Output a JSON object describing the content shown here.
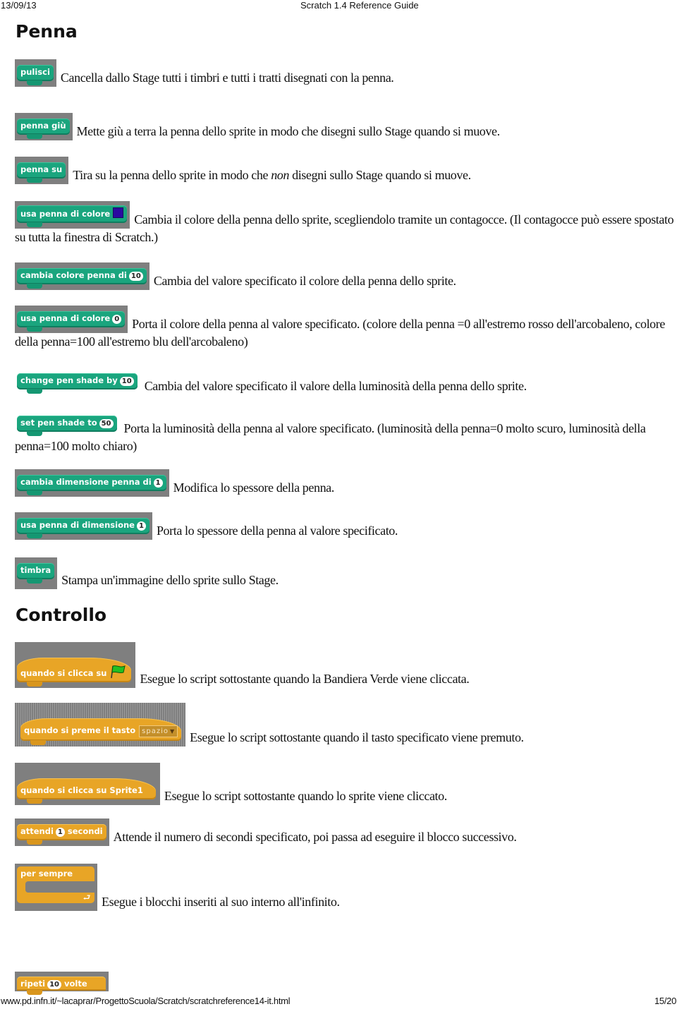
{
  "header": {
    "date": "13/09/13",
    "title": "Scratch 1.4 Reference Guide"
  },
  "footer": {
    "url": "www.pd.infn.it/~lacaprar/ProgettoScuola/Scratch/scratchreference14-it.html",
    "page": "15/20"
  },
  "sections": {
    "penna": {
      "title": "Penna",
      "blocks": [
        {
          "label": "pulisci",
          "desc": "Cancella dallo Stage tutti i timbri e tutti i tratti disegnati con la penna."
        },
        {
          "label": "penna giù",
          "desc": "Mette giù a terra la penna dello sprite in modo che disegni sullo Stage quando si muove."
        },
        {
          "label": "penna su",
          "desc_before": "Tira su la penna dello sprite in modo che ",
          "desc_em": "non",
          "desc_after": " disegni sullo Stage quando si muove."
        },
        {
          "label": "usa penna di colore",
          "swatch_color": "#2a0aa0",
          "desc": "Cambia il colore della penna dello sprite, scegliendolo tramite un contagocce. (Il contagocce può essere spostato su tutta la finestra di Scratch.)"
        },
        {
          "label": "cambia colore penna di",
          "value": "10",
          "desc": "Cambia del valore specificato il colore della penna dello sprite."
        },
        {
          "label": "usa penna di colore",
          "value": "0",
          "desc": "Porta il colore della penna al valore specificato. (colore della penna =0 all'estremo rosso dell'arcobaleno, colore della penna=100 all'estremo blu dell'arcobaleno)"
        },
        {
          "label": "change pen shade by",
          "value": "10",
          "desc": "Cambia del valore specificato il valore della luminosità della penna dello sprite."
        },
        {
          "label": "set pen shade to",
          "value": "50",
          "desc": "Porta la luminosità della penna al valore specificato. (luminosità della penna=0 molto scuro, luminosità della penna=100 molto chiaro)"
        },
        {
          "label": "cambia dimensione penna di",
          "value": "1",
          "desc": "Modifica lo spessore della penna."
        },
        {
          "label": "usa penna di dimensione",
          "value": "1",
          "desc": "Porta lo spessore della penna al valore specificato."
        },
        {
          "label": "timbra",
          "desc": "Stampa un'immagine dello sprite sullo Stage."
        }
      ]
    },
    "controllo": {
      "title": "Controllo",
      "blocks": [
        {
          "label": "quando si clicca su",
          "icon": "green-flag",
          "desc": "Esegue lo script sottostante quando la Bandiera Verde viene cliccata."
        },
        {
          "label": "quando si preme il tasto",
          "dropdown": "spazio",
          "desc": "Esegue lo script sottostante quando il tasto specificato viene premuto."
        },
        {
          "label": "quando si clicca su  Sprite1",
          "desc": "Esegue lo script sottostante quando lo sprite viene cliccato."
        },
        {
          "label_before": "attendi",
          "value": "1",
          "label_after": "secondi",
          "desc": "Attende il numero di secondi specificato, poi passa ad eseguire il blocco successivo."
        },
        {
          "label": "per sempre",
          "desc": "Esegue i blocchi inseriti al suo interno all'infinito."
        },
        {
          "label_before": "ripeti",
          "value": "10",
          "label_after": "volte"
        }
      ]
    }
  }
}
